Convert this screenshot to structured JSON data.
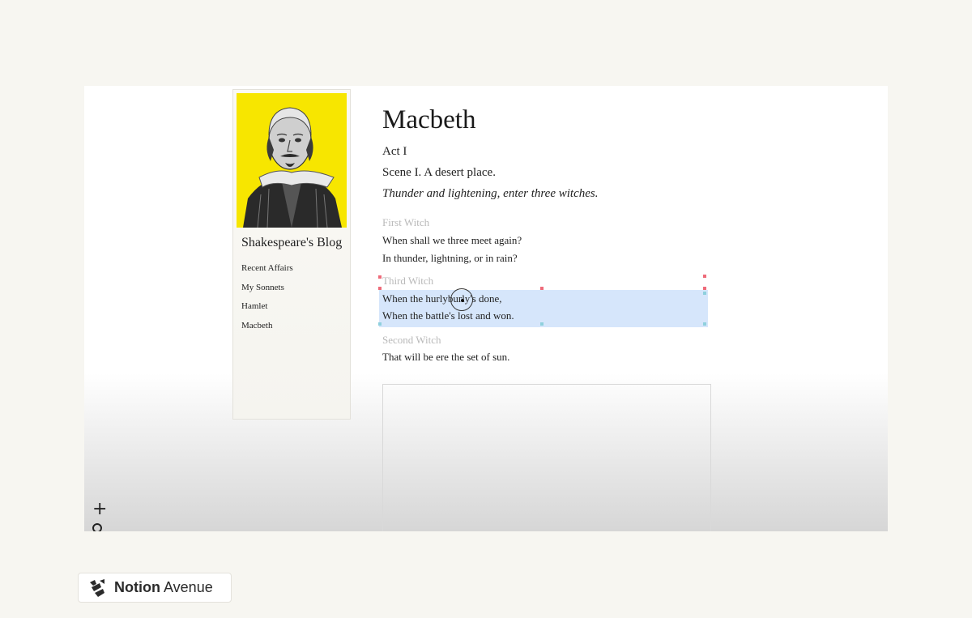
{
  "sidebar": {
    "blog_title": "Shakespeare's Blog",
    "nav": [
      "Recent Affairs",
      "My Sonnets",
      "Hamlet",
      "Macbeth"
    ],
    "portrait_bg": "#f7e600"
  },
  "play": {
    "title": "Macbeth",
    "act": "Act I",
    "scene": "Scene I. A desert place.",
    "direction": "Thunder and lightening, enter three witches.",
    "speeches": [
      {
        "speaker": "First Witch",
        "lines": [
          "When shall we three meet again?",
          "In thunder, lightning, or in rain?"
        ]
      },
      {
        "speaker": "Third Witch",
        "lines": [
          "When the hurlyburly's done,",
          "When the battle's lost and won."
        ]
      },
      {
        "speaker": "Second Witch",
        "lines": [
          "That will be ere the set of sun."
        ]
      }
    ]
  },
  "brand": {
    "name_bold": "Notion",
    "name_regular": " Avenue"
  },
  "colors": {
    "selection": "#d6e6fb",
    "handle_red": "#ee6b7a",
    "handle_teal": "#8fd0dd"
  },
  "icons": {
    "add": "plus-icon",
    "more": "circle-icon",
    "brand": "notion-avenue-logo-icon"
  }
}
